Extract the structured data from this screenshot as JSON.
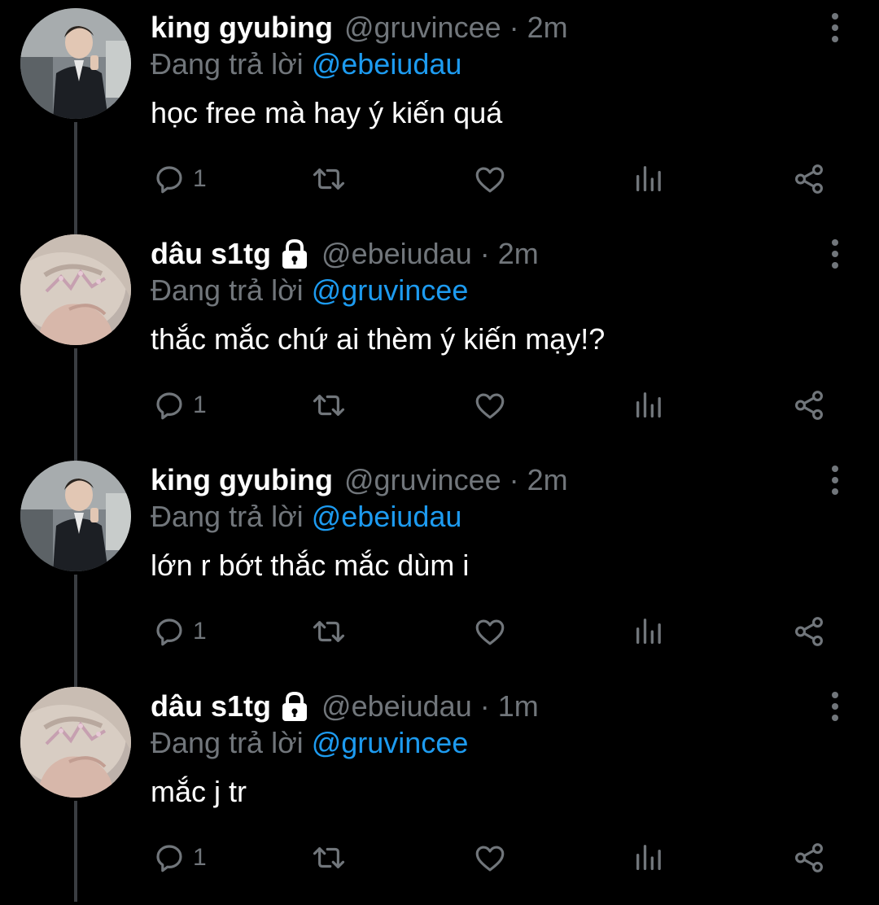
{
  "colors": {
    "background": "#000000",
    "text": "#ffffff",
    "secondary": "#71767b",
    "mention": "#1d9bf0",
    "thread_line": "#3a3d41"
  },
  "tweets": [
    {
      "display_name": "king gyubing",
      "locked": false,
      "handle": "@gruvincee",
      "separator": "·",
      "time": "2m",
      "reply_prefix": "Đang trả lời",
      "reply_to": "@ebeiudau",
      "text": "học free mà hay ý kiến quá",
      "reply_count": "1",
      "avatar": "boy-in-school-uniform"
    },
    {
      "display_name": "dâu s1tg",
      "locked": true,
      "handle": "@ebeiudau",
      "separator": "·",
      "time": "2m",
      "reply_prefix": "Đang trả lời",
      "reply_to": "@gruvincee",
      "text": "thắc mắc chứ ai thèm ý kiến mạy!?",
      "reply_count": "1",
      "avatar": "blonde-hair-tiara"
    },
    {
      "display_name": "king gyubing",
      "locked": false,
      "handle": "@gruvincee",
      "separator": "·",
      "time": "2m",
      "reply_prefix": "Đang trả lời",
      "reply_to": "@ebeiudau",
      "text": "lớn r bớt thắc mắc dùm i",
      "reply_count": "1",
      "avatar": "boy-in-school-uniform"
    },
    {
      "display_name": "dâu s1tg",
      "locked": true,
      "handle": "@ebeiudau",
      "separator": "·",
      "time": "1m",
      "reply_prefix": "Đang trả lời",
      "reply_to": "@gruvincee",
      "text": "mắc j tr",
      "reply_count": "1",
      "avatar": "blonde-hair-tiara"
    }
  ],
  "icons": [
    "reply-icon",
    "retweet-icon",
    "like-icon",
    "analytics-icon",
    "share-icon",
    "more-options-icon",
    "lock-icon"
  ]
}
